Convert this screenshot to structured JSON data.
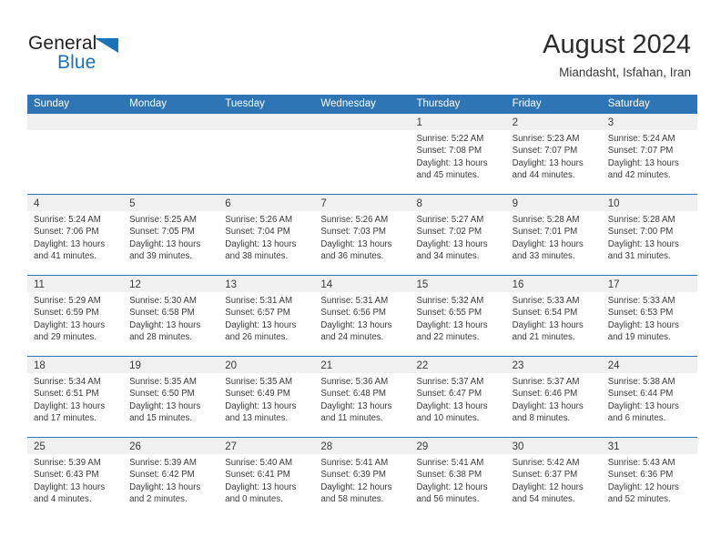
{
  "brand": {
    "name_part1": "General",
    "name_part2": "Blue",
    "triangle_color": "#1a72b8",
    "text_color": "#231f20"
  },
  "header": {
    "title": "August 2024",
    "subtitle": "Miandasht, Isfahan, Iran"
  },
  "theme": {
    "header_blue": "#2e75b6",
    "day_band_gray": "#f0f0f0",
    "text_color": "#3a3a3a"
  },
  "weekdays": [
    "Sunday",
    "Monday",
    "Tuesday",
    "Wednesday",
    "Thursday",
    "Friday",
    "Saturday"
  ],
  "weeks": [
    [
      {
        "day": "",
        "lines": []
      },
      {
        "day": "",
        "lines": []
      },
      {
        "day": "",
        "lines": []
      },
      {
        "day": "",
        "lines": []
      },
      {
        "day": "1",
        "lines": [
          "Sunrise: 5:22 AM",
          "Sunset: 7:08 PM",
          "Daylight: 13 hours",
          "and 45 minutes."
        ]
      },
      {
        "day": "2",
        "lines": [
          "Sunrise: 5:23 AM",
          "Sunset: 7:07 PM",
          "Daylight: 13 hours",
          "and 44 minutes."
        ]
      },
      {
        "day": "3",
        "lines": [
          "Sunrise: 5:24 AM",
          "Sunset: 7:07 PM",
          "Daylight: 13 hours",
          "and 42 minutes."
        ]
      }
    ],
    [
      {
        "day": "4",
        "lines": [
          "Sunrise: 5:24 AM",
          "Sunset: 7:06 PM",
          "Daylight: 13 hours",
          "and 41 minutes."
        ]
      },
      {
        "day": "5",
        "lines": [
          "Sunrise: 5:25 AM",
          "Sunset: 7:05 PM",
          "Daylight: 13 hours",
          "and 39 minutes."
        ]
      },
      {
        "day": "6",
        "lines": [
          "Sunrise: 5:26 AM",
          "Sunset: 7:04 PM",
          "Daylight: 13 hours",
          "and 38 minutes."
        ]
      },
      {
        "day": "7",
        "lines": [
          "Sunrise: 5:26 AM",
          "Sunset: 7:03 PM",
          "Daylight: 13 hours",
          "and 36 minutes."
        ]
      },
      {
        "day": "8",
        "lines": [
          "Sunrise: 5:27 AM",
          "Sunset: 7:02 PM",
          "Daylight: 13 hours",
          "and 34 minutes."
        ]
      },
      {
        "day": "9",
        "lines": [
          "Sunrise: 5:28 AM",
          "Sunset: 7:01 PM",
          "Daylight: 13 hours",
          "and 33 minutes."
        ]
      },
      {
        "day": "10",
        "lines": [
          "Sunrise: 5:28 AM",
          "Sunset: 7:00 PM",
          "Daylight: 13 hours",
          "and 31 minutes."
        ]
      }
    ],
    [
      {
        "day": "11",
        "lines": [
          "Sunrise: 5:29 AM",
          "Sunset: 6:59 PM",
          "Daylight: 13 hours",
          "and 29 minutes."
        ]
      },
      {
        "day": "12",
        "lines": [
          "Sunrise: 5:30 AM",
          "Sunset: 6:58 PM",
          "Daylight: 13 hours",
          "and 28 minutes."
        ]
      },
      {
        "day": "13",
        "lines": [
          "Sunrise: 5:31 AM",
          "Sunset: 6:57 PM",
          "Daylight: 13 hours",
          "and 26 minutes."
        ]
      },
      {
        "day": "14",
        "lines": [
          "Sunrise: 5:31 AM",
          "Sunset: 6:56 PM",
          "Daylight: 13 hours",
          "and 24 minutes."
        ]
      },
      {
        "day": "15",
        "lines": [
          "Sunrise: 5:32 AM",
          "Sunset: 6:55 PM",
          "Daylight: 13 hours",
          "and 22 minutes."
        ]
      },
      {
        "day": "16",
        "lines": [
          "Sunrise: 5:33 AM",
          "Sunset: 6:54 PM",
          "Daylight: 13 hours",
          "and 21 minutes."
        ]
      },
      {
        "day": "17",
        "lines": [
          "Sunrise: 5:33 AM",
          "Sunset: 6:53 PM",
          "Daylight: 13 hours",
          "and 19 minutes."
        ]
      }
    ],
    [
      {
        "day": "18",
        "lines": [
          "Sunrise: 5:34 AM",
          "Sunset: 6:51 PM",
          "Daylight: 13 hours",
          "and 17 minutes."
        ]
      },
      {
        "day": "19",
        "lines": [
          "Sunrise: 5:35 AM",
          "Sunset: 6:50 PM",
          "Daylight: 13 hours",
          "and 15 minutes."
        ]
      },
      {
        "day": "20",
        "lines": [
          "Sunrise: 5:35 AM",
          "Sunset: 6:49 PM",
          "Daylight: 13 hours",
          "and 13 minutes."
        ]
      },
      {
        "day": "21",
        "lines": [
          "Sunrise: 5:36 AM",
          "Sunset: 6:48 PM",
          "Daylight: 13 hours",
          "and 11 minutes."
        ]
      },
      {
        "day": "22",
        "lines": [
          "Sunrise: 5:37 AM",
          "Sunset: 6:47 PM",
          "Daylight: 13 hours",
          "and 10 minutes."
        ]
      },
      {
        "day": "23",
        "lines": [
          "Sunrise: 5:37 AM",
          "Sunset: 6:46 PM",
          "Daylight: 13 hours",
          "and 8 minutes."
        ]
      },
      {
        "day": "24",
        "lines": [
          "Sunrise: 5:38 AM",
          "Sunset: 6:44 PM",
          "Daylight: 13 hours",
          "and 6 minutes."
        ]
      }
    ],
    [
      {
        "day": "25",
        "lines": [
          "Sunrise: 5:39 AM",
          "Sunset: 6:43 PM",
          "Daylight: 13 hours",
          "and 4 minutes."
        ]
      },
      {
        "day": "26",
        "lines": [
          "Sunrise: 5:39 AM",
          "Sunset: 6:42 PM",
          "Daylight: 13 hours",
          "and 2 minutes."
        ]
      },
      {
        "day": "27",
        "lines": [
          "Sunrise: 5:40 AM",
          "Sunset: 6:41 PM",
          "Daylight: 13 hours",
          "and 0 minutes."
        ]
      },
      {
        "day": "28",
        "lines": [
          "Sunrise: 5:41 AM",
          "Sunset: 6:39 PM",
          "Daylight: 12 hours",
          "and 58 minutes."
        ]
      },
      {
        "day": "29",
        "lines": [
          "Sunrise: 5:41 AM",
          "Sunset: 6:38 PM",
          "Daylight: 12 hours",
          "and 56 minutes."
        ]
      },
      {
        "day": "30",
        "lines": [
          "Sunrise: 5:42 AM",
          "Sunset: 6:37 PM",
          "Daylight: 12 hours",
          "and 54 minutes."
        ]
      },
      {
        "day": "31",
        "lines": [
          "Sunrise: 5:43 AM",
          "Sunset: 6:36 PM",
          "Daylight: 12 hours",
          "and 52 minutes."
        ]
      }
    ]
  ]
}
